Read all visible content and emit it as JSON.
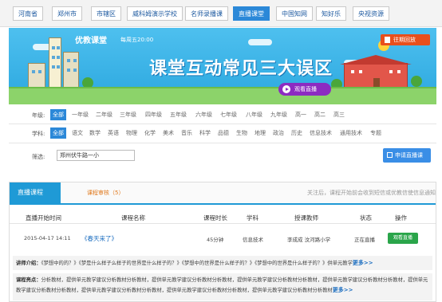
{
  "nav": {
    "items": [
      {
        "label": "河南省",
        "active": false
      },
      {
        "label": "郑州市",
        "active": false
      },
      {
        "label": "市辖区",
        "active": false
      },
      {
        "label": "威科姆演示学校",
        "active": false
      },
      {
        "label": "名师录播课",
        "active": false
      },
      {
        "label": "直播课堂",
        "active": true
      },
      {
        "label": "中国知网",
        "active": false
      },
      {
        "label": "知好乐",
        "active": false
      },
      {
        "label": "央视资源",
        "active": false
      }
    ]
  },
  "banner": {
    "brand": "优教课堂",
    "schedule": "每周五20:00",
    "headline": "课堂互动常见三大误区",
    "watch_label": "观看直播",
    "replay_label": "往期回放"
  },
  "filters": {
    "grade_label": "年级:",
    "grades": [
      "全部",
      "一年级",
      "二年级",
      "三年级",
      "四年级",
      "五年级",
      "六年级",
      "七年级",
      "八年级",
      "九年级",
      "高一",
      "高二",
      "高三"
    ],
    "subject_label": "学科:",
    "subjects": [
      "全部",
      "语文",
      "数学",
      "英语",
      "物理",
      "化学",
      "美术",
      "音乐",
      "科学",
      "品德",
      "生物",
      "地理",
      "政治",
      "历史",
      "信息技术",
      "通用技术",
      "专题"
    ],
    "search_label": "筛选:",
    "search_value": "郑州伏牛路一小",
    "apply_label": "申请直播课"
  },
  "panel": {
    "tab_live": "直播课程",
    "tab_review": "课程审核（5）",
    "hint": "关注后，课程开始前会收到短信或优教信使信息通知",
    "columns": [
      "直播开始时间",
      "课程名称",
      "课程时长",
      "学科",
      "授课教师",
      "状态",
      "操作"
    ],
    "row": {
      "start": "2015-04-17 14:11",
      "title": "《春天来了》",
      "duration": "45分钟",
      "subject": "信息技术",
      "teacher": "李成成 汶河路小学",
      "status": "正在直播",
      "action": "观看直播"
    },
    "intro_label": "讲师介绍：",
    "intro_text": "《梦想中的的？》《梦是什么样子么样子的世界是什么样子的？》《梦想中的世界是什么样子的？》《梦想中的世界是什么样子的？》供单元教学",
    "more_label": "更多>>",
    "highlight_label": "课程亮点：",
    "highlight_text": "分析教材，提供单元教学建议分析教材分析教材，提供单元教学建议分析教材分析教材，提供单元教学建议分析教材分析教材，提供单元教学建议分析教材分析教材，提供单元教学建议分析教材分析教材，提供单元教学建议分析教材分析教材，提供单元教学建议分析教材分析教材，提供单元教学建议分析教材分析教材"
  }
}
